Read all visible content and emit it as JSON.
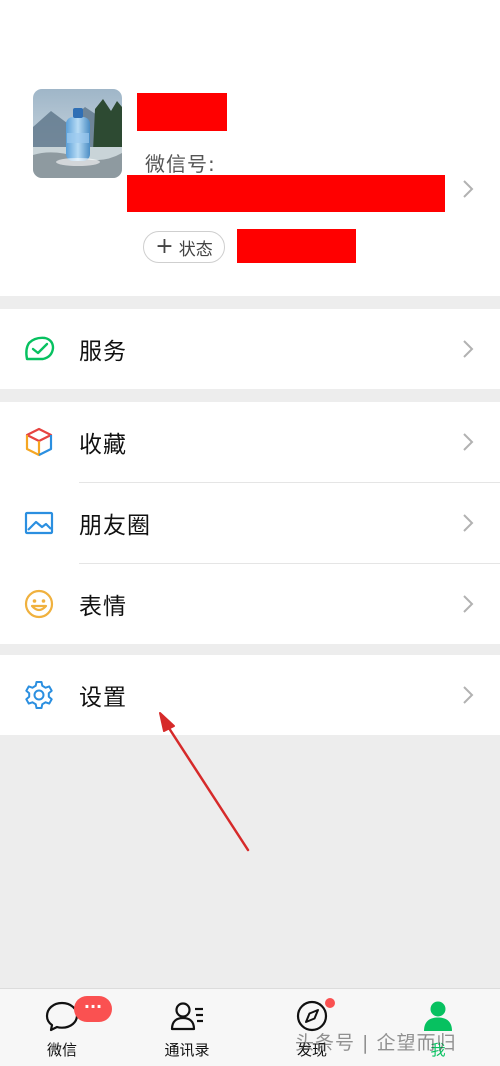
{
  "profile": {
    "wechat_id_label": "微信号:",
    "status_plus": "+",
    "status_label": "状态",
    "avatar_icon": "water-bottle-photo"
  },
  "menu": {
    "services": {
      "label": "服务",
      "icon": "wallet-check-icon"
    },
    "favorites": {
      "label": "收藏",
      "icon": "cube-icon"
    },
    "moments": {
      "label": "朋友圈",
      "icon": "picture-icon"
    },
    "stickers": {
      "label": "表情",
      "icon": "smiley-icon"
    },
    "settings": {
      "label": "设置",
      "icon": "gear-icon"
    }
  },
  "tabbar": {
    "tabs": [
      {
        "label": "微信",
        "icon": "chat-bubble-icon"
      },
      {
        "label": "通讯录",
        "icon": "contacts-icon"
      },
      {
        "label": "发现",
        "icon": "compass-icon"
      },
      {
        "label": "我",
        "icon": "person-icon"
      }
    ],
    "chat_badge": "···"
  },
  "watermark": "头条号 | 企望而归",
  "colors": {
    "accent_green": "#07c160",
    "badge_red": "#fa5151",
    "redaction_red": "#ff0000",
    "annotation_arrow": "#d62a2a"
  }
}
